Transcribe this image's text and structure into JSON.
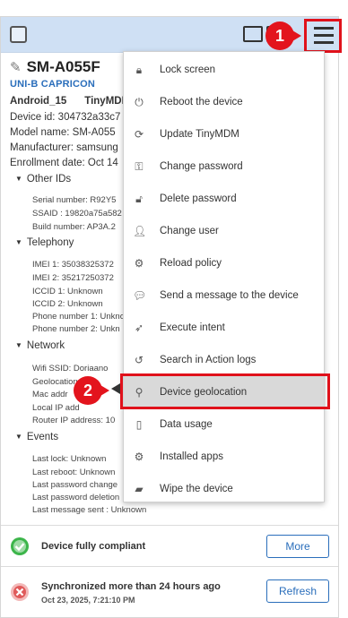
{
  "device": {
    "name": "SM-A055F",
    "company": "UNI-B CAPRICON",
    "os": "Android_15",
    "agent": "TinyMDM",
    "device_id": "Device id: 304732a33c7",
    "model": "Model name: SM-A055",
    "manufacturer": "Manufacturer: samsung",
    "enrollment": "Enrollment date: Oct 14"
  },
  "sections": {
    "other_ids": {
      "title": "Other IDs",
      "lines": [
        "Serial number: R92Y5",
        "SSAID : 19820a75a582",
        "Build number: AP3A.2"
      ]
    },
    "telephony": {
      "title": "Telephony",
      "lines": [
        "IMEI 1: 35038325372",
        "IMEI 2: 35217250372",
        "ICCID 1: Unknown",
        "ICCID 2: Unknown",
        "Phone number 1: Unkno",
        "Phone number 2: Unkn"
      ]
    },
    "network": {
      "title": "Network",
      "lines": [
        "Wifi SSID: Doriaano",
        "Geolocation",
        "Mac addr",
        "Local IP add",
        "Router IP address: 10"
      ]
    },
    "events": {
      "title": "Events",
      "lines": [
        "Last lock: Unknown",
        "Last reboot: Unknown",
        "Last password change",
        "Last password deletion",
        "Last message sent : Unknown"
      ]
    }
  },
  "status": {
    "compliance": "Device fully compliant",
    "more_label": "More",
    "sync": "Synchronized more than 24 hours ago",
    "sync_date": "Oct 23, 2025, 7:21:10 PM",
    "refresh_label": "Refresh"
  },
  "menu": {
    "items": [
      {
        "label": "Lock screen",
        "icon": "lock-icon"
      },
      {
        "label": "Reboot the device",
        "icon": "power-icon"
      },
      {
        "label": "Update TinyMDM",
        "icon": "refresh-icon"
      },
      {
        "label": "Change password",
        "icon": "key-icon"
      },
      {
        "label": "Delete password",
        "icon": "unlock-icon"
      },
      {
        "label": "Change user",
        "icon": "user-icon"
      },
      {
        "label": "Reload policy",
        "icon": "gears-icon"
      },
      {
        "label": "Send a message to the device",
        "icon": "chat-icon"
      },
      {
        "label": "Execute intent",
        "icon": "rocket-icon"
      },
      {
        "label": "Search in Action logs",
        "icon": "history-icon"
      },
      {
        "label": "Device geolocation",
        "icon": "map-marker-icon"
      },
      {
        "label": "Data usage",
        "icon": "phone-icon"
      },
      {
        "label": "Installed apps",
        "icon": "gear-icon"
      },
      {
        "label": "Wipe the device",
        "icon": "eraser-icon"
      }
    ]
  },
  "callouts": {
    "one": "1",
    "two": "2"
  },
  "colors": {
    "accent": "#2a6ebb",
    "callout": "#e3141d",
    "topbar": "#cfe0f4",
    "ok": "#3cb54a",
    "error": "#e05a5a"
  }
}
